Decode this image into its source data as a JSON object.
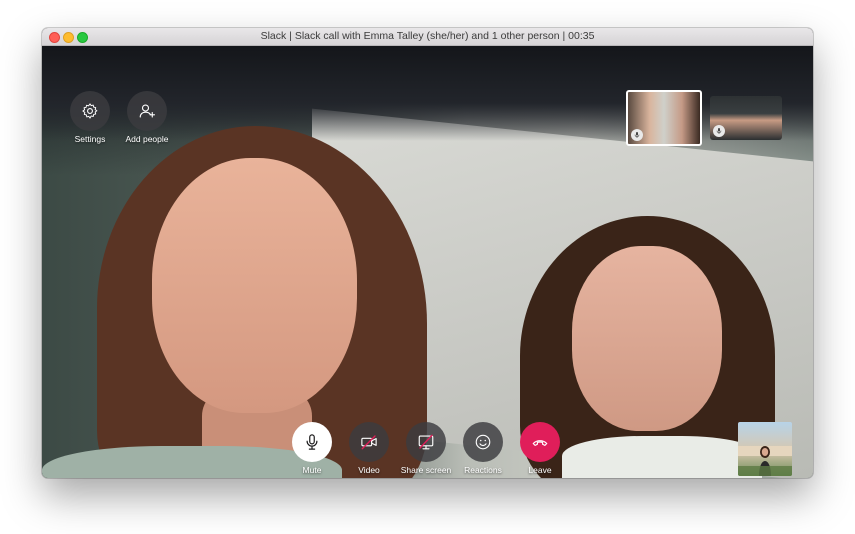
{
  "window": {
    "title": "Slack | Slack call with Emma Talley (she/her) and 1 other person | 00:35"
  },
  "top_controls": [
    {
      "label": "Settings",
      "icon": "gear-icon"
    },
    {
      "label": "Add people",
      "icon": "add-person-icon"
    }
  ],
  "participants": [
    {
      "icon": "microphone-icon",
      "active": true
    },
    {
      "icon": "microphone-icon",
      "active": false
    }
  ],
  "bottom_controls": [
    {
      "label": "Mute",
      "icon": "microphone-icon"
    },
    {
      "label": "Video",
      "icon": "video-off-icon"
    },
    {
      "label": "Share screen",
      "icon": "share-screen-off-icon"
    },
    {
      "label": "Reactions",
      "icon": "smiley-icon"
    },
    {
      "label": "Leave",
      "icon": "hang-up-icon"
    }
  ],
  "colors": {
    "leave": "#e01e5a",
    "control_bg": "#3c3c40",
    "mute_bg": "#ffffff"
  }
}
